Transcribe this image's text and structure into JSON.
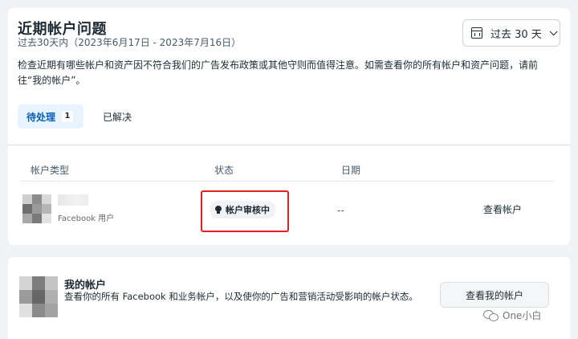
{
  "recent_issues": {
    "title": "近期帐户问题",
    "subtitle": "过去30天内（2023年6月17日 - 2023年7月16日）",
    "description": "检查近期有哪些帐户和资产因不符合我们的广告发布政策或其他守则而值得注意。如需查看你的所有帐户和资产问题，请前往“我的帐户”。",
    "date_filter": {
      "label": "过去 30 天",
      "icon": "calendar-icon"
    },
    "tabs": [
      {
        "label": "待处理",
        "count": "1",
        "selected": true
      },
      {
        "label": "已解决",
        "selected": false
      }
    ],
    "table": {
      "headers": {
        "type": "帐户类型",
        "status": "状态",
        "date": "日期"
      },
      "rows": [
        {
          "account_type": "Facebook 用户",
          "status": "帐户审核中",
          "status_icon": "lightbulb-icon",
          "date": "--",
          "action": "查看帐户"
        }
      ]
    }
  },
  "my_account": {
    "title": "我的帐户",
    "description": "查看你的所有 Facebook 和业务帐户，以及使你的广告和营销活动受影响的帐户状态。",
    "button": "查看我的帐户"
  },
  "watermark": {
    "text": "One小白",
    "icon": "wechat-icon"
  },
  "colors": {
    "accent": "#0a5eb8",
    "tab_bg": "#e7f3ff",
    "highlight": "#e41e1e",
    "page_bg": "#f0f2f5"
  }
}
